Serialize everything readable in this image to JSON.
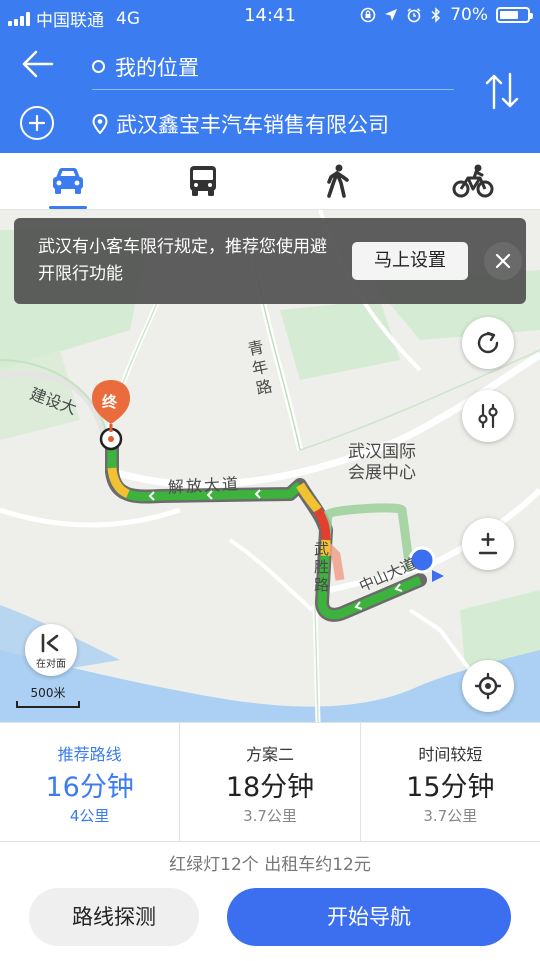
{
  "status_bar": {
    "carrier": "中国联通",
    "network": "4G",
    "time": "14:41",
    "battery": "70%",
    "battery_level": 0.7
  },
  "search": {
    "origin": "我的位置",
    "destination": "武汉鑫宝丰汽车销售有限公司"
  },
  "modes": [
    "car-icon",
    "bus-icon",
    "walk-icon",
    "bike-icon"
  ],
  "notice": {
    "text": "武汉有小客车限行规定，推荐您使用避开限行功能",
    "button": "马上设置"
  },
  "map": {
    "labels": {
      "end_marker": "终",
      "jianshe": "建设大",
      "qingnian": "青年路",
      "jiefang": "解放大道",
      "expo": "武汉国际会展中心",
      "wusheng": "武胜路",
      "zhongshan": "中山大道"
    },
    "opposite_label": "在对面",
    "scale": "500米"
  },
  "routes": [
    {
      "name": "推荐路线",
      "time": "16分钟",
      "distance": "4公里",
      "selected": true
    },
    {
      "name": "方案二",
      "time": "18分钟",
      "distance": "3.7公里",
      "selected": false
    },
    {
      "name": "时间较短",
      "time": "15分钟",
      "distance": "3.7公里",
      "selected": false
    }
  ],
  "info": "红绿灯12个  出租车约12元",
  "buttons": {
    "probe": "路线探测",
    "navigate": "开始导航"
  },
  "colors": {
    "brand": "#3b7cf0",
    "traffic_green": "#3db33d",
    "traffic_yellow": "#f2c232",
    "traffic_red": "#e2402f"
  }
}
